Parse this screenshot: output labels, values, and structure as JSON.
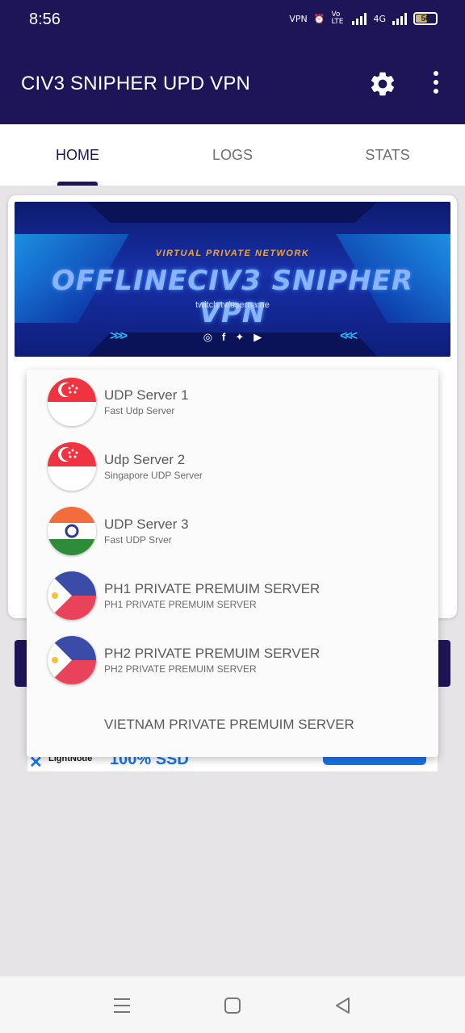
{
  "status_bar": {
    "time": "8:56",
    "vpn_label": "VPN",
    "volte_label": "Vo LTE",
    "network_label": "4G",
    "battery_level": "56"
  },
  "app_bar": {
    "title": "CIV3 SNIPHER UPD VPN",
    "settings_icon": "gear-icon",
    "menu_icon": "more-vert-icon"
  },
  "tabs": [
    {
      "label": "HOME",
      "active": true
    },
    {
      "label": "LOGS",
      "active": false
    },
    {
      "label": "STATS",
      "active": false
    }
  ],
  "banner": {
    "subtitle": "VIRTUAL PRIVATE NETWORK",
    "title": "OFFLINECIV3 SNIPHER VPN",
    "url": "twitch.tv/username"
  },
  "servers": [
    {
      "name": "UDP Server 1",
      "description": "Fast Udp Server",
      "flag": "singapore"
    },
    {
      "name": "Udp Server 2",
      "description": "Singapore UDP Server",
      "flag": "singapore"
    },
    {
      "name": "UDP Server 3",
      "description": "Fast UDP Srver",
      "flag": "india"
    },
    {
      "name": "PH1 PRIVATE PREMUIM SERVER",
      "description": "PH1 PRIVATE PREMUIM SERVER",
      "flag": "philippines"
    },
    {
      "name": "PH2 PRIVATE PREMUIM SERVER",
      "description": "PH2 PRIVATE PREMUIM SERVER",
      "flag": "philippines"
    },
    {
      "name": "VIETNAM PRIVATE PREMUIM SERVER",
      "description": "",
      "flag": "none"
    }
  ],
  "ad": {
    "brand": "LightNode",
    "headline": "100% SSD"
  },
  "colors": {
    "primary": "#1e1559",
    "background": "#e6e4e6"
  }
}
